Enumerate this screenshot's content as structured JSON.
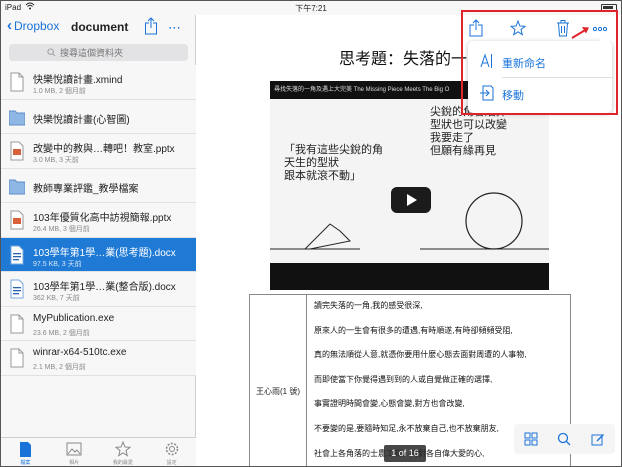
{
  "status_bar": {
    "carrier": "iPad",
    "wifi_icon": "wifi-icon",
    "time": "下午7:21"
  },
  "sidebar": {
    "back_label": "Dropbox",
    "title": "document",
    "search_placeholder": "搜尋這個資料夾",
    "files": [
      {
        "name": "快樂悅讀計畫.xmind",
        "meta": "1.0 MB, 2 個月前",
        "type": "file",
        "icon": "document-icon"
      },
      {
        "name": "快樂悅讀計畫(心智圖)",
        "meta": "",
        "type": "folder",
        "icon": "folder-icon"
      },
      {
        "name": "改變中的教與…轉吧！教室.pptx",
        "meta": "3.0 MB, 3 天前",
        "type": "file",
        "icon": "presentation-icon"
      },
      {
        "name": "教師專業評鑑_教學檔案",
        "meta": "",
        "type": "folder",
        "icon": "folder-icon"
      },
      {
        "name": "103年優質化高中訪視簡報.pptx",
        "meta": "26.4 MB, 3 個月前",
        "type": "file",
        "icon": "presentation-icon"
      },
      {
        "name": "103學年第1學…業(思考題).docx",
        "meta": "97.5 KB, 3 天前",
        "type": "file",
        "icon": "word-document-icon",
        "selected": true
      },
      {
        "name": "103學年第1學…業(整合版).docx",
        "meta": "362 KB, 7 天前",
        "type": "file",
        "icon": "word-document-icon"
      },
      {
        "name": "MyPublication.exe",
        "meta": "23.6 MB, 2 個月前",
        "type": "file",
        "icon": "document-icon"
      },
      {
        "name": "winrar-x64-510tc.exe",
        "meta": "2.1 MB, 2 個月前",
        "type": "file",
        "icon": "document-icon"
      }
    ],
    "tabs": [
      {
        "label": "檔案",
        "icon": "files-icon",
        "active": true
      },
      {
        "label": "相片",
        "icon": "photos-icon",
        "active": false
      },
      {
        "label": "我的最愛",
        "icon": "favorites-icon",
        "active": false
      },
      {
        "label": "設定",
        "icon": "settings-icon",
        "active": false
      }
    ]
  },
  "main": {
    "doc_title": "思考題：失落的一角",
    "video": {
      "caption": "尋找失落的一角及遇上大完美 The Missing Piece Meets The Big O",
      "hand_text_left": [
        "「我有這些尖銳的角",
        "天生的型狀",
        "跟本就滾不動」"
      ],
      "hand_text_right": [
        "尖銳的角會磨掉",
        "型狀也可以改變",
        "我要走了",
        "但願有緣再見"
      ]
    },
    "table": {
      "student": "王心雨(1 號)",
      "lines": [
        "讀完失落的一角,我的感受很深,",
        "原來人的一生會有很多的遭遇,有時順遂,有時卻頻頻受阻,",
        "真的無法順從人意,就憑你要用什麼心態去面對周遭的人事物,",
        "而即使當下你覺得遇到到的人或自覺做正確的選擇,",
        "事實證明時間會變,心態會變,對方也會改變,",
        "不要變的是,要隨時知足,永不放棄自己,也不放棄朋友,",
        "社會上各角落的士農工商，的對各自偉大愛的心,"
      ]
    },
    "page_indicator": "1 of 16",
    "bottom_tools": [
      "grid-icon",
      "search-icon",
      "edit-icon"
    ],
    "toolbar_icons": [
      "share-icon",
      "star-icon",
      "trash-icon",
      "more-icon"
    ]
  },
  "popover": {
    "items": [
      {
        "label": "重新命名",
        "icon": "rename-icon"
      },
      {
        "label": "移動",
        "icon": "move-icon"
      }
    ]
  },
  "colors": {
    "accent": "#1a73d9",
    "selected_row": "#1f7ad6",
    "highlight": "#e0242b"
  }
}
